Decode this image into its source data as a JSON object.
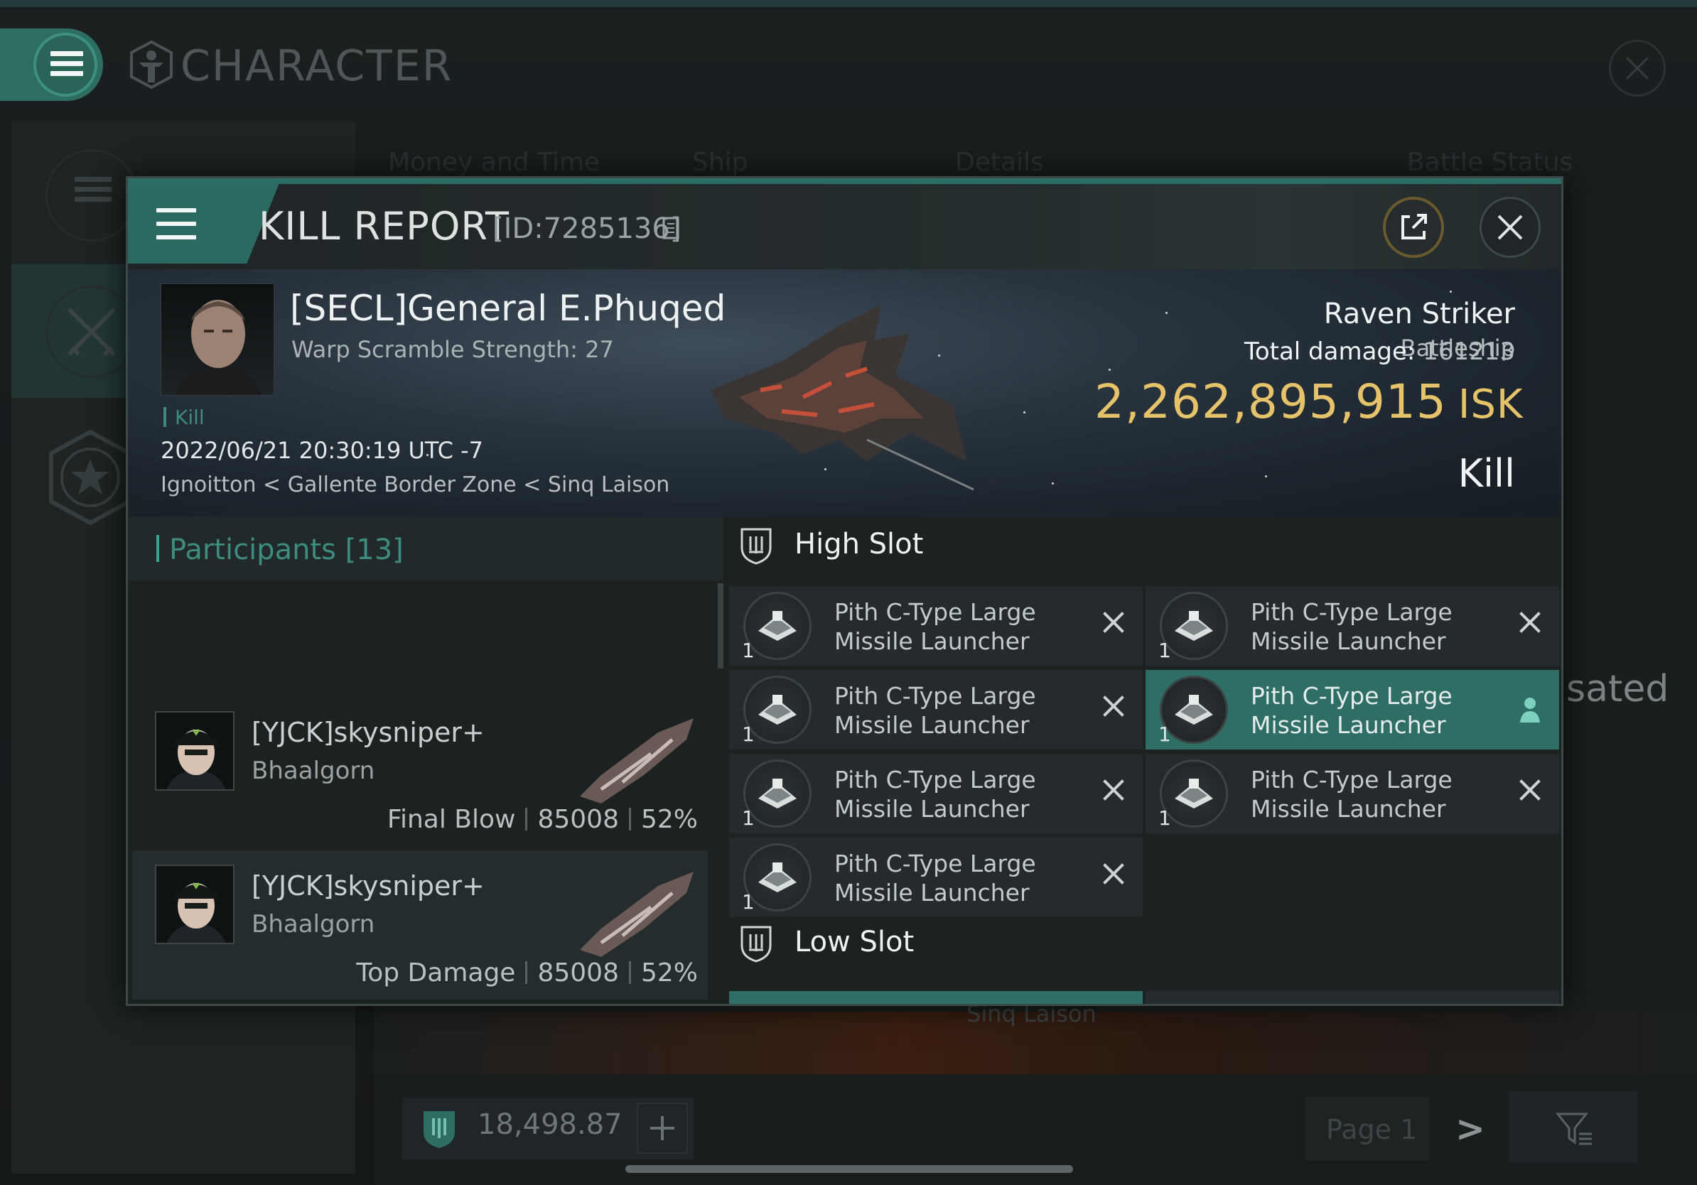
{
  "app": {
    "title": "CHARACTER",
    "accent_color": "#2e6d62",
    "background_tabs": [
      "Money and Time",
      "Ship",
      "Details",
      "Battle Status"
    ],
    "background_partial_text": "sated",
    "background_partial_location": "Sinq Laison",
    "wallet": {
      "amount": "18,498.87"
    },
    "pagination": {
      "label": "Page 1"
    }
  },
  "modal": {
    "title": "KILL REPORT",
    "id_label": "[ID:7285136]",
    "victim": {
      "name": "[SECL]General E.Phuqed",
      "warp_scramble": "Warp Scramble Strength: 27",
      "tag": "Kill",
      "timestamp": "2022/06/21 20:30:19 UTC -7",
      "location": "Ignoitton < Gallente Border Zone < Sinq Laison"
    },
    "ship": {
      "name": "Raven Striker",
      "class": "Battleship",
      "total_damage_label": "Total damage:",
      "total_damage_value": "161213",
      "isk_value": "2,262,895,915",
      "isk_unit": "ISK",
      "result": "Kill"
    },
    "participants": {
      "title": "Participants [13]",
      "rows": [
        {
          "name": "[YJCK]skysniper+",
          "ship": "Bhaalgorn",
          "role": "Final Blow",
          "damage": "85008",
          "percent": "52%"
        },
        {
          "name": "[YJCK]skysniper+",
          "ship": "Bhaalgorn",
          "role": "Top Damage",
          "damage": "85008",
          "percent": "52%"
        }
      ]
    },
    "high_slot": {
      "title": "High Slot",
      "modules": [
        {
          "qty": "1",
          "name": "Pith C-Type Large Missile Launcher",
          "status": "destroyed"
        },
        {
          "qty": "1",
          "name": "Pith C-Type Large Missile Launcher",
          "status": "destroyed"
        },
        {
          "qty": "1",
          "name": "Pith C-Type Large Missile Launcher",
          "status": "destroyed"
        },
        {
          "qty": "1",
          "name": "Pith C-Type Large Missile Launcher",
          "status": "dropped"
        },
        {
          "qty": "1",
          "name": "Pith C-Type Large Missile Launcher",
          "status": "destroyed"
        },
        {
          "qty": "1",
          "name": "Pith C-Type Large Missile Launcher",
          "status": "destroyed"
        },
        {
          "qty": "1",
          "name": "Pith C-Type Large Missile Launcher",
          "status": "destroyed"
        }
      ]
    },
    "low_slot": {
      "title": "Low Slot"
    }
  }
}
